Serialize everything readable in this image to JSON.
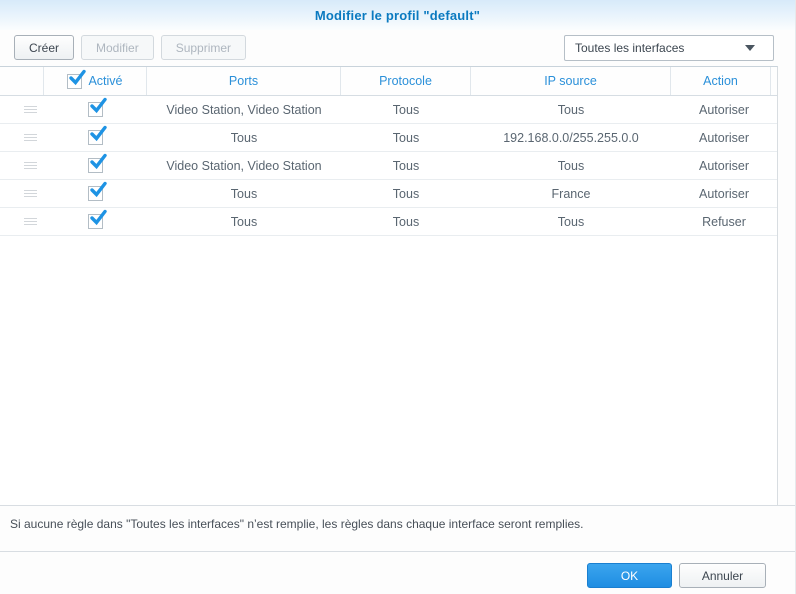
{
  "dialog": {
    "title": "Modifier le profil \"default\""
  },
  "toolbar": {
    "create_label": "Créer",
    "modify_label": "Modifier",
    "delete_label": "Supprimer",
    "interface_select": {
      "value": "Toutes les interfaces"
    }
  },
  "table": {
    "columns": {
      "enabled": "Activé",
      "ports": "Ports",
      "protocol": "Protocole",
      "ip_source": "IP source",
      "action": "Action"
    },
    "rows": [
      {
        "enabled": true,
        "ports": "Video Station, Video Station",
        "protocol": "Tous",
        "ip_source": "Tous",
        "action": "Autoriser"
      },
      {
        "enabled": true,
        "ports": "Tous",
        "protocol": "Tous",
        "ip_source": "192.168.0.0/255.255.0.0",
        "action": "Autoriser"
      },
      {
        "enabled": true,
        "ports": "Video Station, Video Station",
        "protocol": "Tous",
        "ip_source": "Tous",
        "action": "Autoriser"
      },
      {
        "enabled": true,
        "ports": "Tous",
        "protocol": "Tous",
        "ip_source": "France",
        "action": "Autoriser"
      },
      {
        "enabled": true,
        "ports": "Tous",
        "protocol": "Tous",
        "ip_source": "Tous",
        "action": "Refuser"
      }
    ]
  },
  "note": "Si aucune règle dans \"Toutes les interfaces\" n’est remplie, les règles dans chaque interface seront remplies.",
  "footer": {
    "ok_label": "OK",
    "cancel_label": "Annuler"
  },
  "colors": {
    "title_blue": "#0b7ac0",
    "header_blue": "#2b90d9",
    "check_blue": "#1e93e4",
    "ok_button_blue": "#2a9be8",
    "row_text": "#5a6671"
  }
}
